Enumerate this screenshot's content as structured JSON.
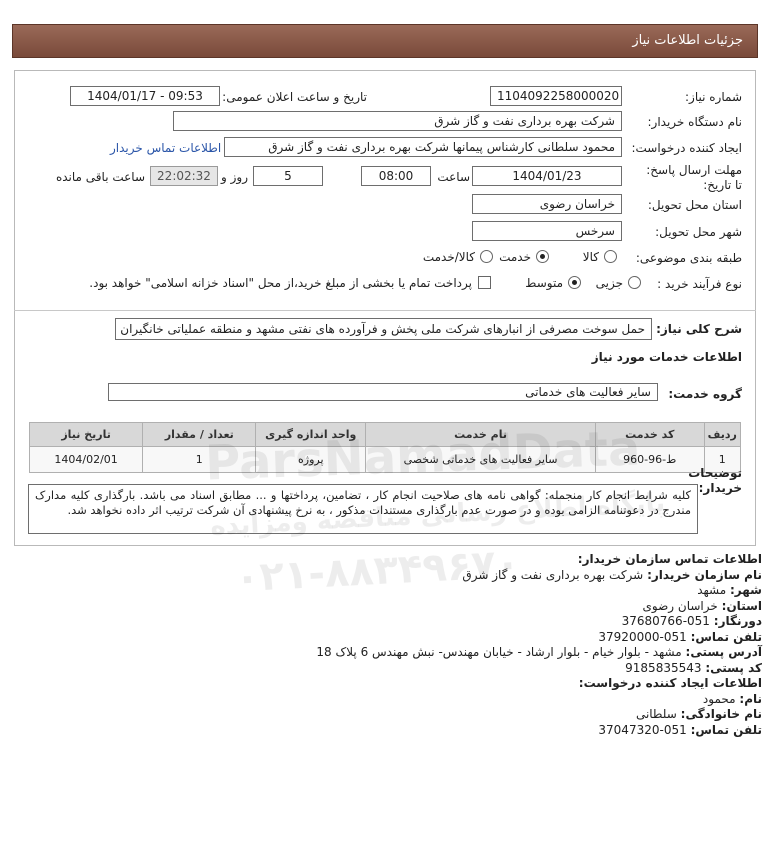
{
  "page": {
    "title": "جزئیات اطلاعات نیاز"
  },
  "form": {
    "need_number": {
      "label": "شماره نیاز:",
      "value": "1104092258000020"
    },
    "announce": {
      "label": "تاریخ و ساعت اعلان عمومی:",
      "value": "1404/01/17 - 09:53"
    },
    "buyer_org": {
      "label": "نام دستگاه خریدار:",
      "value": "شرکت بهره برداری نفت و گاز شرق"
    },
    "requester": {
      "label": "ایجاد کننده درخواست:",
      "value": "محمود سلطانی کارشناس پیمانها شرکت بهره برداری نفت و گاز شرق",
      "contact_link": "اطلاعات تماس خریدار"
    },
    "deadline": {
      "label": "مهلت ارسال پاسخ: تا تاریخ:",
      "date": "1404/01/23",
      "time_label": "ساعت",
      "time": "08:00",
      "days": "5",
      "days_label": "روز و",
      "remaining": "22:02:32",
      "remaining_label": "ساعت باقی مانده"
    },
    "province": {
      "label": "استان محل تحویل:",
      "value": "خراسان رضوی"
    },
    "city": {
      "label": "شهر محل تحویل:",
      "value": "سرخس"
    },
    "category": {
      "label": "طبقه بندی موضوعی:",
      "options": [
        "کالا",
        "خدمت",
        "کالا/خدمت"
      ],
      "selected": "خدمت"
    },
    "process": {
      "label": "نوع فرآیند خرید :",
      "options": [
        "جزیی",
        "متوسط"
      ],
      "selected": "متوسط",
      "payment_note": "پرداخت تمام یا بخشی از مبلغ خرید،از محل \"اسناد خزانه اسلامی\" خواهد بود."
    }
  },
  "description": {
    "label": "شرح کلی نیاز:",
    "value": "حمل سوخت مصرفی از انبارهای شرکت ملی پخش و فرآورده های نفتی مشهد و منطقه عملیاتی خانگیران"
  },
  "services": {
    "section_title": "اطلاعات خدمات مورد نیاز",
    "group_label": "گروه خدمت:",
    "group_value": "سایر فعالیت های خدماتی",
    "table": {
      "headers": [
        "ردیف",
        "کد خدمت",
        "نام خدمت",
        "واحد اندازه گیری",
        "تعداد / مقدار",
        "تاریخ نیاز"
      ],
      "rows": [
        [
          "1",
          "ط-96-960",
          "سایر فعالیت های خدماتی شخصی",
          "پروژه",
          "1",
          "1404/02/01"
        ]
      ]
    }
  },
  "buyer_notes": {
    "label": "توضیحات خریدار:",
    "value": "کلیه شرایط انجام کار منجمله: گواهی نامه های صلاحیت انجام کار ، تضامین، پرداختها و ... مطابق اسناد می باشد. بارگذاری کلیه مدارک مندرج در دعوتنامه الزامی بوده و در صورت عدم بارگذاری مستندات مذکور ، به نرخ پیشنهادی آن شرکت ترتیب اثر داده نخواهد شد."
  },
  "contact": {
    "title": "اطلاعات تماس سازمان خریدار:",
    "org_label": "نام سازمان خریدار:",
    "org": "شرکت بهره برداری نفت و گاز شرق",
    "city_label": "شهر:",
    "city": "مشهد",
    "province_label": "استان:",
    "province": "خراسان رضوی",
    "fax_label": "دورنگار:",
    "fax": "051-37680766",
    "phone_label": "تلفن تماس:",
    "phone": "051-37920000",
    "address_label": "آدرس پستی:",
    "address": "مشهد - بلوار خیام - بلوار ارشاد - خیابان مهندس- نبش مهندس 6 پلاک 18",
    "postal_label": "کد پستی:",
    "postal": "9185835543",
    "creator_title": "اطلاعات ایجاد کننده درخواست:",
    "name_label": "نام:",
    "name": "محمود",
    "family_label": "نام خانوادگی:",
    "family": "سلطانی",
    "creator_phone_label": "تلفن تماس:",
    "creator_phone": "051-37047320"
  },
  "watermark": {
    "brand": "ParsNamadData",
    "tagline": "پایگاه اطلاع رسانی مناقصه ومزایده",
    "phone": "۰۲۱-۸۸۳۴۹۶۷۰"
  }
}
